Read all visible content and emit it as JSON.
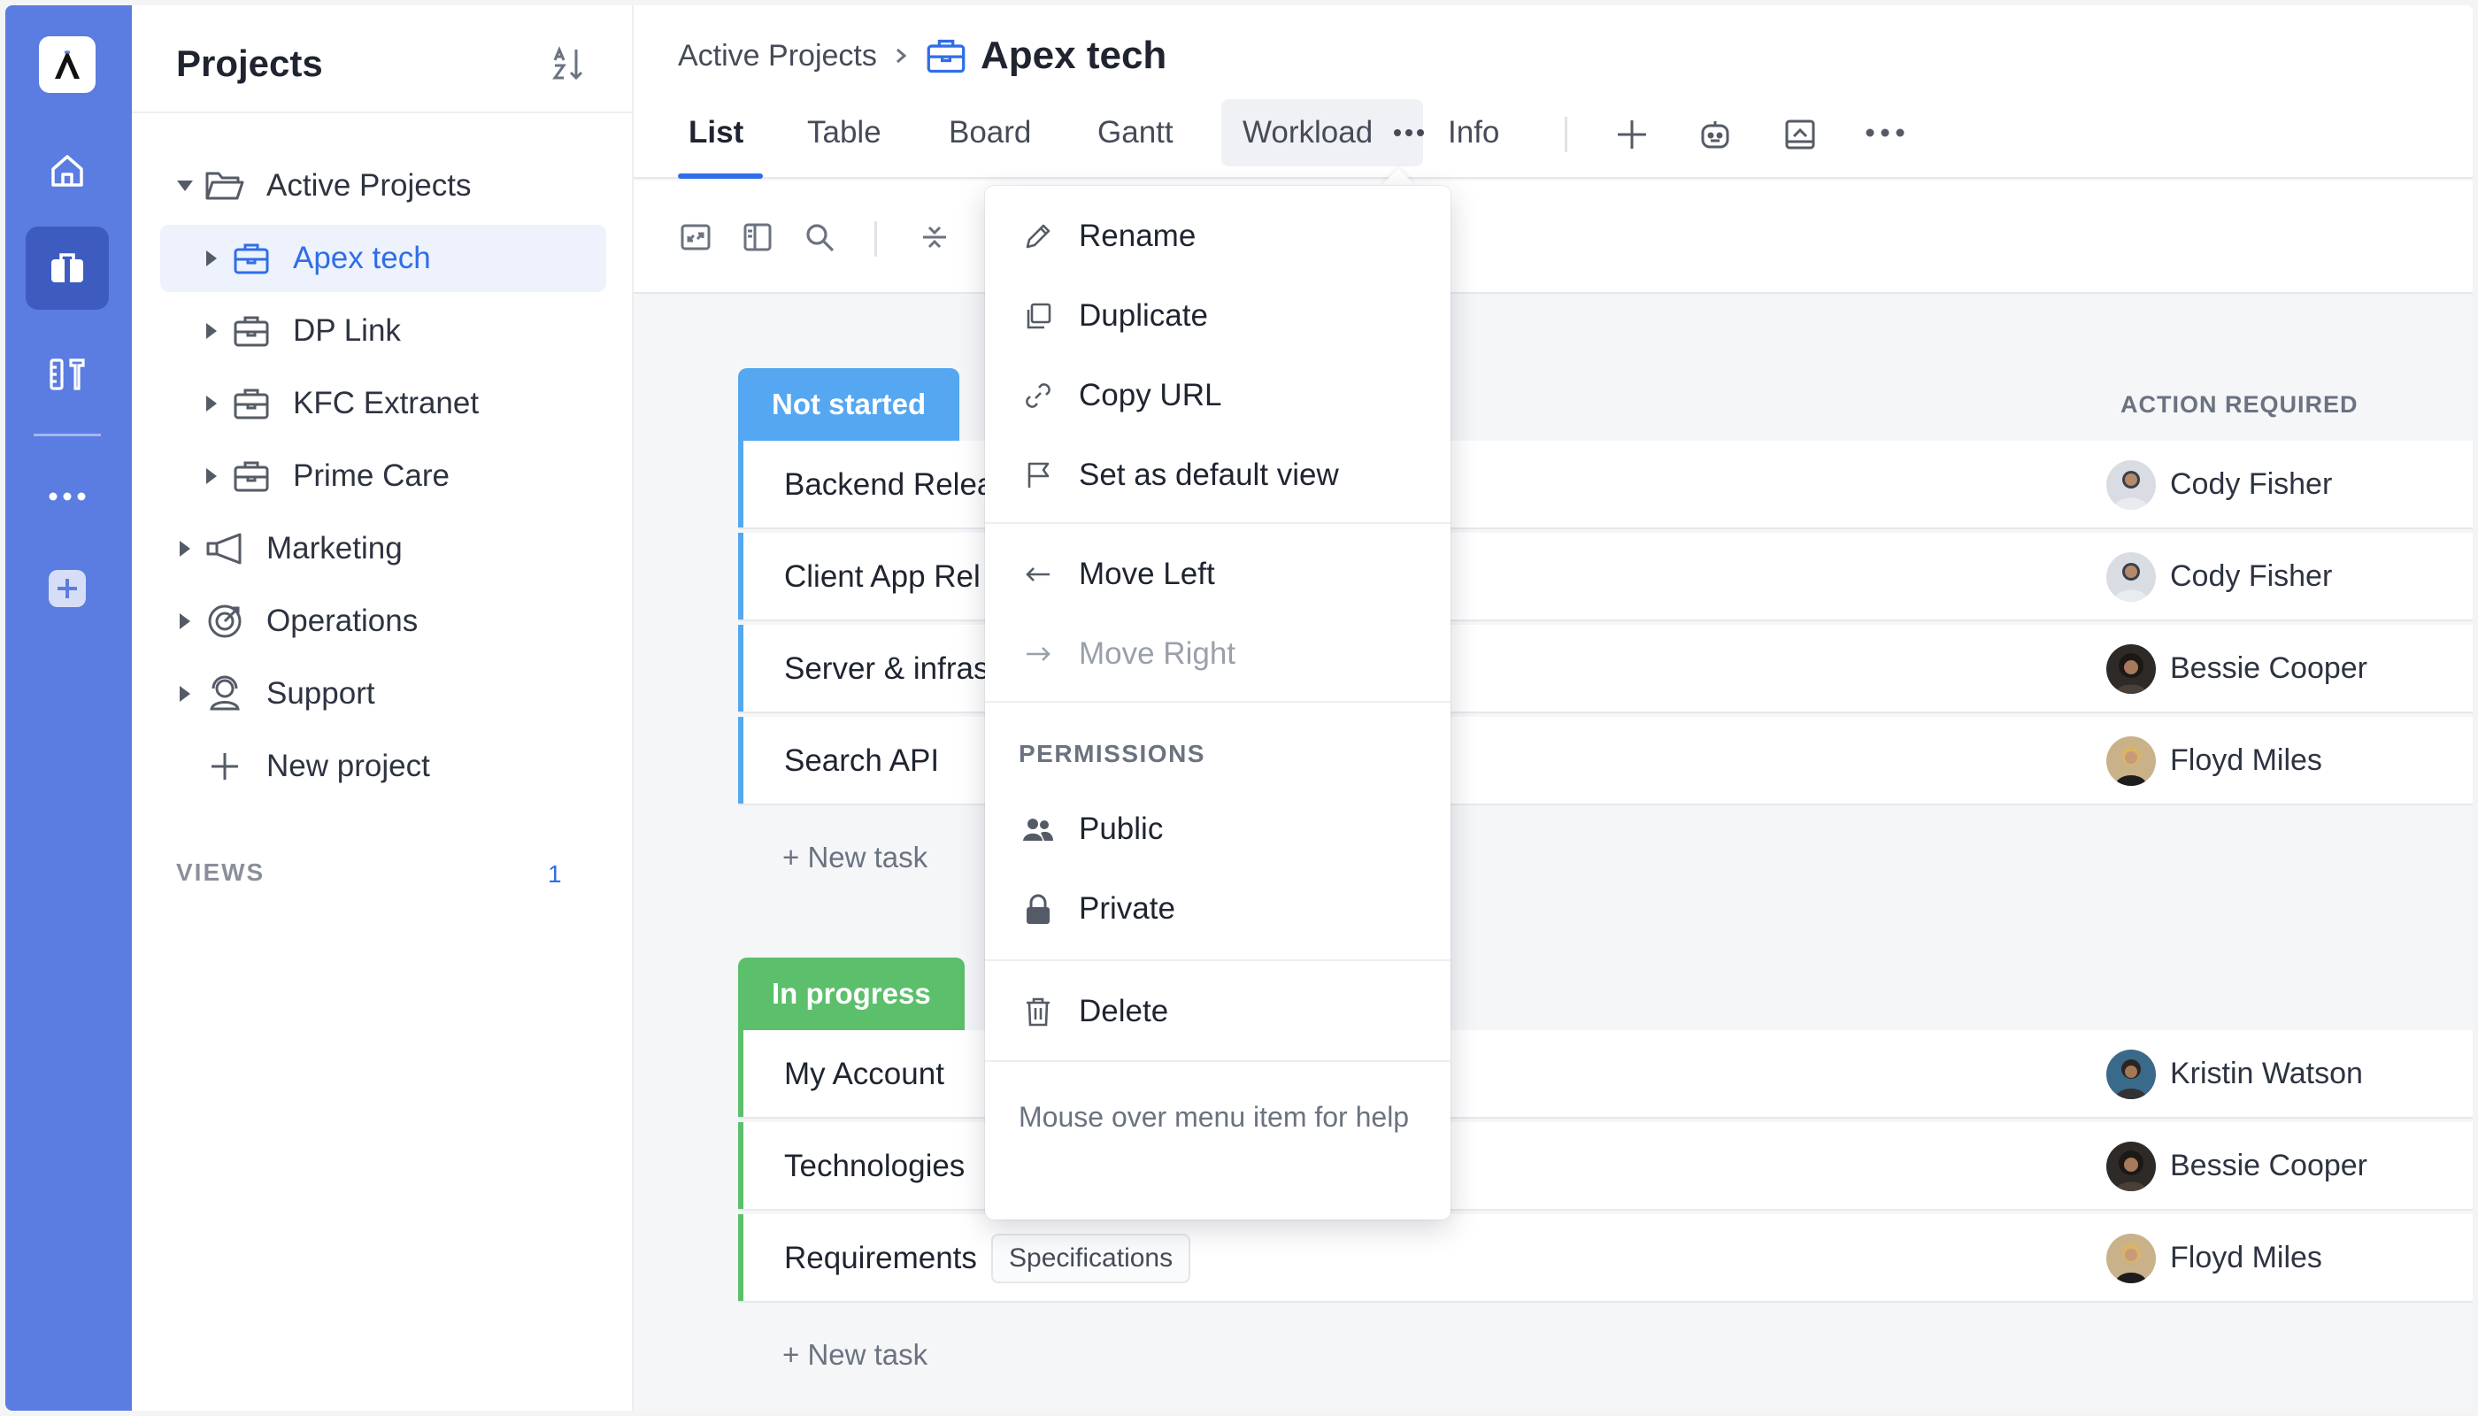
{
  "rail": {
    "logo_icon": "app-logo-icon",
    "items": [
      "home-icon",
      "briefcase-icon",
      "tools-icon",
      "more-icon",
      "add-icon"
    ],
    "accent": "#5b7ce0"
  },
  "sidebar": {
    "title": "Projects",
    "tree": [
      {
        "label": "Active Projects",
        "icon": "folder-open-icon",
        "expanded": true
      },
      {
        "label": "Apex tech",
        "icon": "briefcase-icon",
        "selected": true
      },
      {
        "label": "DP Link",
        "icon": "briefcase-icon"
      },
      {
        "label": "KFC Extranet",
        "icon": "briefcase-icon"
      },
      {
        "label": "Prime Care",
        "icon": "briefcase-icon"
      },
      {
        "label": "Marketing",
        "icon": "megaphone-icon"
      },
      {
        "label": "Operations",
        "icon": "target-icon"
      },
      {
        "label": "Support",
        "icon": "support-icon"
      },
      {
        "label": "New project",
        "icon": "plus-icon"
      }
    ],
    "views_label": "VIEWS",
    "views_count": "1"
  },
  "header": {
    "breadcrumb_parent": "Active Projects",
    "title": "Apex tech",
    "tabs": [
      "List",
      "Table",
      "Board",
      "Gantt",
      "Workload",
      "Info"
    ],
    "active_tab": "List"
  },
  "columns": {
    "action_required": "ACTION REQUIRED"
  },
  "groups": [
    {
      "label": "Not started",
      "color": "#54a7f0",
      "tasks": [
        {
          "name": "Backend Relea",
          "assignee": "Cody Fisher"
        },
        {
          "name": "Client App Rel",
          "assignee": "Cody Fisher"
        },
        {
          "name": "Server & infras",
          "assignee": "Bessie Cooper"
        },
        {
          "name": "Search API",
          "assignee": "Floyd Miles"
        }
      ],
      "new_task": "+ New task"
    },
    {
      "label": "In progress",
      "color": "#5cbf6b",
      "tasks": [
        {
          "name": "My Account",
          "assignee": "Kristin Watson"
        },
        {
          "name": "Technologies",
          "assignee": "Bessie Cooper"
        },
        {
          "name": "Requirements",
          "tag": "Specifications",
          "assignee": "Floyd Miles"
        }
      ],
      "new_task": "+ New task"
    }
  ],
  "menu": {
    "items": [
      {
        "label": "Rename",
        "icon": "pencil-icon"
      },
      {
        "label": "Duplicate",
        "icon": "duplicate-icon"
      },
      {
        "label": "Copy URL",
        "icon": "link-icon"
      },
      {
        "label": "Set as default view",
        "icon": "flag-icon"
      },
      {
        "label": "Move Left",
        "icon": "arrow-left-icon"
      },
      {
        "label": "Move Right",
        "icon": "arrow-right-icon",
        "disabled": true
      }
    ],
    "permissions_heading": "PERMISSIONS",
    "permissions": [
      {
        "label": "Public",
        "icon": "users-icon",
        "checked": true
      },
      {
        "label": "Private",
        "icon": "lock-icon"
      }
    ],
    "delete_label": "Delete",
    "help_text": "Mouse over menu item for help"
  }
}
